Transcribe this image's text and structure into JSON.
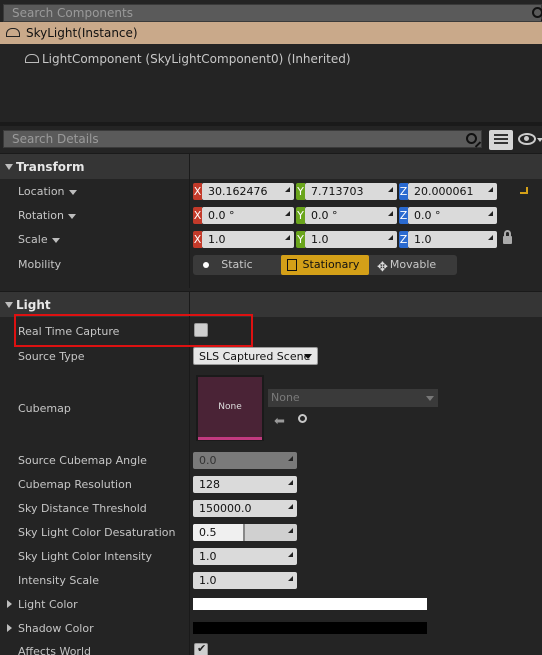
{
  "components": {
    "search_placeholder": "Search Components",
    "root": "SkyLight(Instance)",
    "child": "LightComponent (SkyLightComponent0) (Inherited)"
  },
  "details": {
    "search_placeholder": "Search Details"
  },
  "transform": {
    "title": "Transform",
    "location": {
      "label": "Location",
      "x": "30.162476",
      "y": "7.713703",
      "z": "20.000061"
    },
    "rotation": {
      "label": "Rotation",
      "x": "0.0 °",
      "y": "0.0 °",
      "z": "0.0 °"
    },
    "scale": {
      "label": "Scale",
      "x": "1.0",
      "y": "1.0",
      "z": "1.0"
    },
    "axis": {
      "x": "X",
      "y": "Y",
      "z": "Z"
    },
    "mobility": {
      "label": "Mobility",
      "options": [
        "Static",
        "Stationary",
        "Movable"
      ],
      "selected": "Stationary"
    }
  },
  "light": {
    "title": "Light",
    "real_time_capture": {
      "label": "Real Time Capture",
      "checked": false
    },
    "source_type": {
      "label": "Source Type",
      "value": "SLS Captured Scene"
    },
    "cubemap": {
      "label": "Cubemap",
      "thumb_text": "None",
      "asset_value": "None"
    },
    "source_cubemap_angle": {
      "label": "Source Cubemap Angle",
      "value": "0.0"
    },
    "cubemap_resolution": {
      "label": "Cubemap Resolution",
      "value": "128"
    },
    "sky_distance_threshold": {
      "label": "Sky Distance Threshold",
      "value": "150000.0"
    },
    "color_desaturation": {
      "label": "Sky Light Color Desaturation",
      "value": "0.5",
      "fraction": 0.5
    },
    "color_intensity": {
      "label": "Sky Light Color Intensity",
      "value": "1.0"
    },
    "intensity_scale": {
      "label": "Intensity Scale",
      "value": "1.0"
    },
    "light_color": {
      "label": "Light Color",
      "color": "#ffffff"
    },
    "shadow_color": {
      "label": "Shadow Color",
      "color": "#000000"
    },
    "affects_world": {
      "label": "Affects World",
      "checked": true
    }
  },
  "colors": {
    "accent": "#d4a018",
    "header_bg": "#c9a98a",
    "highlight": "#dd1111"
  }
}
